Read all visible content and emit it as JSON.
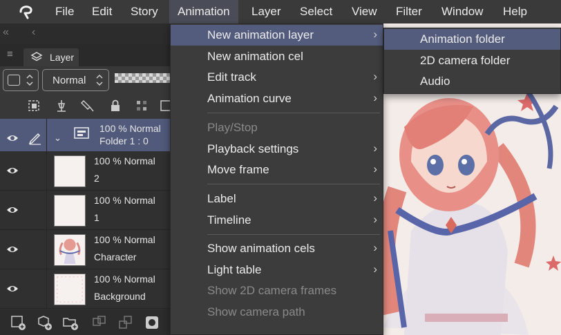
{
  "menubar": {
    "logo": "clip-studio-logo-icon",
    "items": [
      "File",
      "Edit",
      "Story",
      "Animation",
      "Layer",
      "Select",
      "View",
      "Filter",
      "Window",
      "Help"
    ],
    "active": "Animation"
  },
  "left_panel": {
    "collapse_glyph": "«",
    "back_glyph": "‹",
    "menu_glyph": "≡",
    "tab_label": "Layer",
    "blend_mode": "Normal",
    "layers": [
      {
        "line1": "100 %  Normal",
        "line2": "Folder 1 : 0",
        "kind": "animation-folder",
        "selected": true
      },
      {
        "line1": "100 %  Normal",
        "line2": "2",
        "kind": "cel"
      },
      {
        "line1": "100 %  Normal",
        "line2": "1",
        "kind": "cel"
      },
      {
        "line1": "100 %  Normal",
        "line2": "Character",
        "kind": "character"
      },
      {
        "line1": "100 %  Normal",
        "line2": "Background",
        "kind": "background"
      }
    ]
  },
  "animation_menu": {
    "items": [
      {
        "label": "New animation layer",
        "submenu": true,
        "highlighted": true
      },
      {
        "label": "New animation cel"
      },
      {
        "label": "Edit track",
        "submenu": true
      },
      {
        "label": "Animation curve",
        "submenu": true
      },
      {
        "label": "Play/Stop",
        "disabled": true
      },
      {
        "label": "Playback settings",
        "submenu": true
      },
      {
        "label": "Move frame",
        "submenu": true
      },
      {
        "label": "Label",
        "submenu": true
      },
      {
        "label": "Timeline",
        "submenu": true
      },
      {
        "label": "Show animation cels",
        "submenu": true
      },
      {
        "label": "Light table",
        "submenu": true
      },
      {
        "label": "Show 2D camera frames",
        "disabled": true
      },
      {
        "label": "Show camera path",
        "disabled": true
      }
    ],
    "submenu_arrow": "›"
  },
  "new_animation_layer_submenu": {
    "items": [
      {
        "label": "Animation folder",
        "highlighted": true
      },
      {
        "label": "2D camera folder"
      },
      {
        "label": "Audio"
      }
    ]
  },
  "colors": {
    "menu_bg": "#3c3c3c",
    "highlight": "#535c7d",
    "selected_layer": "#515a7a",
    "disabled_text": "#8a8a8a"
  }
}
